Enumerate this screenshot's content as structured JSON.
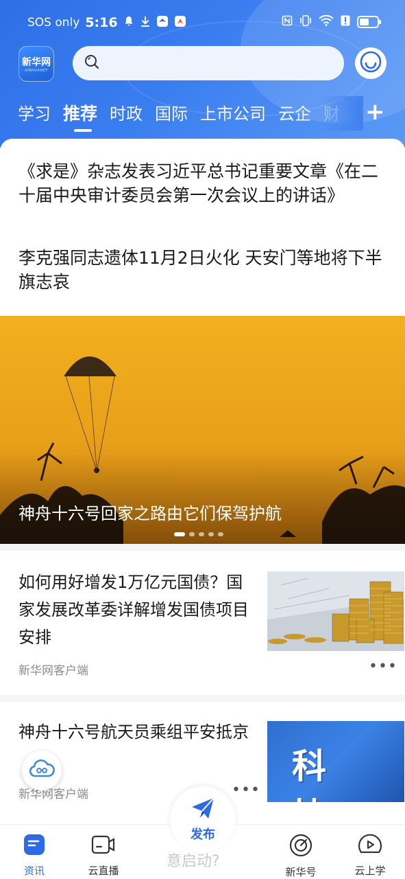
{
  "status_bar": {
    "carrier": "SOS only",
    "time": "5:16",
    "left_icons": [
      "bell-icon",
      "download-icon",
      "bird-app-icon",
      "app-notification-icon"
    ],
    "right_icons": [
      "nfc-icon",
      "vibrate-icon",
      "wifi-icon",
      "alert-icon",
      "battery-icon"
    ],
    "battery_level": 0.55
  },
  "header": {
    "logo_text": "新华网",
    "logo_subtext": "XINHUANET",
    "search": {
      "placeholder": ""
    },
    "tabs": [
      {
        "label": "学习",
        "active": false
      },
      {
        "label": "推荐",
        "active": true
      },
      {
        "label": "时政",
        "active": false
      },
      {
        "label": "国际",
        "active": false
      },
      {
        "label": "上市公司",
        "active": false
      },
      {
        "label": "云企",
        "active": false
      },
      {
        "label": "财",
        "active": false
      }
    ],
    "add_tab_label": "+"
  },
  "headlines": [
    "《求是》杂志发表习近平总书记重要文章《在二十届中央审计委员会第一次会议上的讲话》",
    "李克强同志遗体11月2日火化 天安门等地将下半旗志哀"
  ],
  "banner": {
    "title": "神舟十六号回家之路由它们保驾护航",
    "slide_count": 5,
    "active_slide": 1
  },
  "news": [
    {
      "title": "如何用好增发1万亿元国债？国家发展改革委详解增发国债项目安排",
      "source": "新华网客户端",
      "more": "•••"
    },
    {
      "title": "神舟十六号航天员乘组平安抵京",
      "source": "新华网客户端",
      "more": "•••",
      "thumb_text": "科 技"
    }
  ],
  "bottom_nav": {
    "items": [
      {
        "label": "资讯",
        "icon": "news-icon",
        "active": true
      },
      {
        "label": "云直播",
        "icon": "video-camera-icon",
        "active": false
      },
      {
        "label": "新华号",
        "icon": "target-icon",
        "active": false
      },
      {
        "label": "云上学",
        "icon": "play-cloud-icon",
        "active": false
      }
    ],
    "publish_label": "发布",
    "ghost_text": "意启动?"
  },
  "colors": {
    "brand_blue": "#2d6be4",
    "header_blue": "#3a7df0"
  }
}
